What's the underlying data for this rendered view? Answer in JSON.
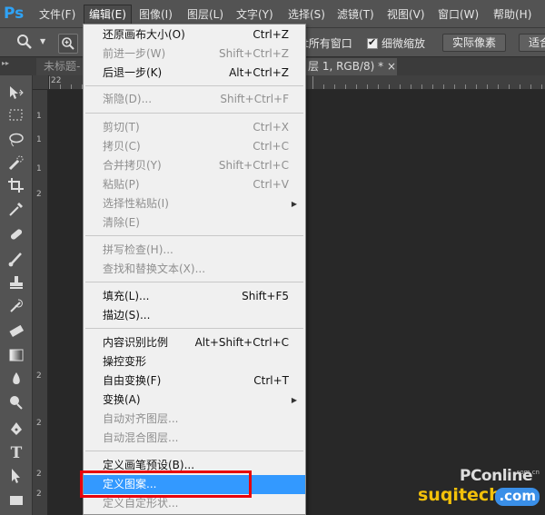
{
  "app": {
    "logo": "Ps"
  },
  "menubar": [
    {
      "label": "文件(F)"
    },
    {
      "label": "编辑(E)"
    },
    {
      "label": "图像(I)"
    },
    {
      "label": "图层(L)"
    },
    {
      "label": "文字(Y)"
    },
    {
      "label": "选择(S)"
    },
    {
      "label": "滤镜(T)"
    },
    {
      "label": "视图(V)"
    },
    {
      "label": "窗口(W)"
    },
    {
      "label": "帮助(H)"
    }
  ],
  "options_bar": {
    "zoom_tool_icon": "zoom-icon",
    "zoom_in_icon": "zoom-in-icon",
    "resize_windows_label": "t所有窗口",
    "scrubby_zoom_label": "细微缩放",
    "actual_pixels_label": "实际像素",
    "fit_screen_label": "适合"
  },
  "document_tabs": [
    {
      "label": "未标题-"
    },
    {
      "label": "层 1, RGB/8) *"
    }
  ],
  "doc_tab_close": "×",
  "ruler": {
    "top_label": "22",
    "left_labels": [
      "1",
      "1",
      "1",
      "2",
      "2",
      "2",
      "2",
      "2"
    ]
  },
  "edit_menu": {
    "items": [
      {
        "label": "还原画布大小(O)",
        "shortcut": "Ctrl+Z",
        "enabled": true
      },
      {
        "label": "前进一步(W)",
        "shortcut": "Shift+Ctrl+Z",
        "enabled": false
      },
      {
        "label": "后退一步(K)",
        "shortcut": "Alt+Ctrl+Z",
        "enabled": true
      },
      {
        "label": "渐隐(D)...",
        "shortcut": "Shift+Ctrl+F",
        "enabled": false
      },
      {
        "label": "剪切(T)",
        "shortcut": "Ctrl+X",
        "enabled": false
      },
      {
        "label": "拷贝(C)",
        "shortcut": "Ctrl+C",
        "enabled": false
      },
      {
        "label": "合并拷贝(Y)",
        "shortcut": "Shift+Ctrl+C",
        "enabled": false
      },
      {
        "label": "粘贴(P)",
        "shortcut": "Ctrl+V",
        "enabled": false
      },
      {
        "label": "选择性粘贴(I)",
        "shortcut": "",
        "enabled": false,
        "submenu": true
      },
      {
        "label": "清除(E)",
        "shortcut": "",
        "enabled": false
      },
      {
        "label": "拼写检查(H)...",
        "shortcut": "",
        "enabled": false
      },
      {
        "label": "查找和替换文本(X)...",
        "shortcut": "",
        "enabled": false
      },
      {
        "label": "填充(L)...",
        "shortcut": "Shift+F5",
        "enabled": true
      },
      {
        "label": "描边(S)...",
        "shortcut": "",
        "enabled": true
      },
      {
        "label": "内容识别比例",
        "shortcut": "Alt+Shift+Ctrl+C",
        "enabled": true
      },
      {
        "label": "操控变形",
        "shortcut": "",
        "enabled": true
      },
      {
        "label": "自由变换(F)",
        "shortcut": "Ctrl+T",
        "enabled": true
      },
      {
        "label": "变换(A)",
        "shortcut": "",
        "enabled": true,
        "submenu": true
      },
      {
        "label": "自动对齐图层...",
        "shortcut": "",
        "enabled": false
      },
      {
        "label": "自动混合图层...",
        "shortcut": "",
        "enabled": false
      },
      {
        "label": "定义画笔预设(B)...",
        "shortcut": "",
        "enabled": true
      },
      {
        "label": "定义图案...",
        "shortcut": "",
        "enabled": true,
        "highlighted": true
      },
      {
        "label": "定义自定形状...",
        "shortcut": "",
        "enabled": false
      }
    ]
  },
  "watermark": {
    "brand": "PConline",
    "brand_small": "com.cn",
    "site": "suqitech",
    "tld": ".com"
  },
  "colors": {
    "menu_highlight": "#3399ff",
    "annotation_box": "#e8000b",
    "ps_logo": "#2fa3f6"
  }
}
